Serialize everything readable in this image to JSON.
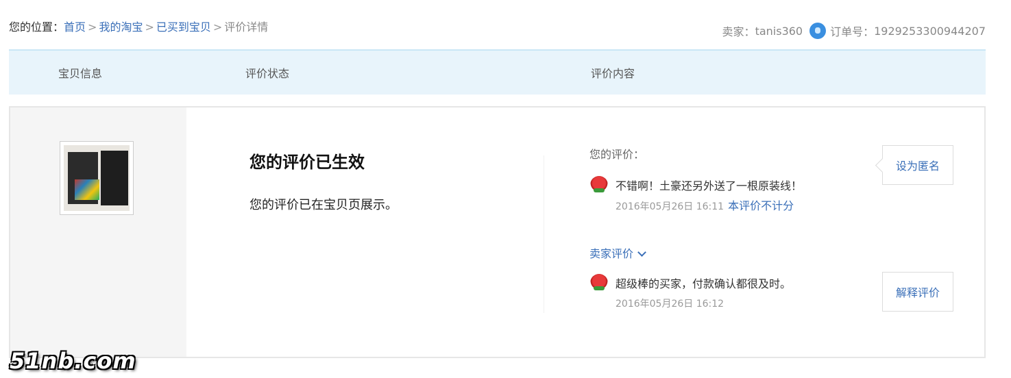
{
  "breadcrumb": {
    "prefix": "您的位置：",
    "items": [
      "首页",
      "我的淘宝",
      "已买到宝贝"
    ],
    "current": "评价详情",
    "separator": ">"
  },
  "order_meta": {
    "seller_label": "卖家：",
    "seller_name": "tanis360",
    "order_label": "订单号：",
    "order_number": "1929253300944207"
  },
  "table_header": {
    "col1": "宝贝信息",
    "col2": "评价状态",
    "col3": "评价内容"
  },
  "status": {
    "title": "您的评价已生效",
    "description": "您的评价已在宝贝页展示。"
  },
  "my_review": {
    "label": "您的评价：",
    "text": "不错啊！土豪还另外送了一根原装线！",
    "date": "2016年05月26日 16:11",
    "note": "本评价不计分",
    "anonymous_button": "设为匿名"
  },
  "seller_review": {
    "toggle_label": "卖家评价",
    "text": "超级棒的买家，付款确认都很及时。",
    "date": "2016年05月26日 16:12",
    "explain_button": "解释评价"
  },
  "watermark": "51nb.com",
  "colors": {
    "link": "#3a6fb8",
    "header_bg": "#e8f4fb"
  }
}
